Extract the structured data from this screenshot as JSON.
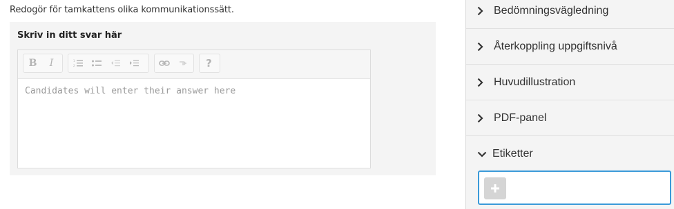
{
  "question": {
    "prompt": "Redogör för tamkattens olika kommunikationssätt.",
    "answer_label": "Skriv in ditt svar här",
    "placeholder": "Candidates will enter their answer here"
  },
  "toolbar": {
    "bold": "B",
    "italic": "I",
    "help": "?"
  },
  "sidebar": {
    "items": [
      {
        "label": "Bedömningsvägledning",
        "state": "collapsed"
      },
      {
        "label": "Återkoppling uppgiftsnivå",
        "state": "collapsed"
      },
      {
        "label": "Huvudillustration",
        "state": "collapsed"
      },
      {
        "label": "PDF-panel",
        "state": "collapsed"
      },
      {
        "label": "Etiketter",
        "state": "expanded"
      }
    ],
    "tags_add_label": "+"
  },
  "colors": {
    "focus_border": "#3a9ad9",
    "panel_bg": "#f4f4f4"
  }
}
